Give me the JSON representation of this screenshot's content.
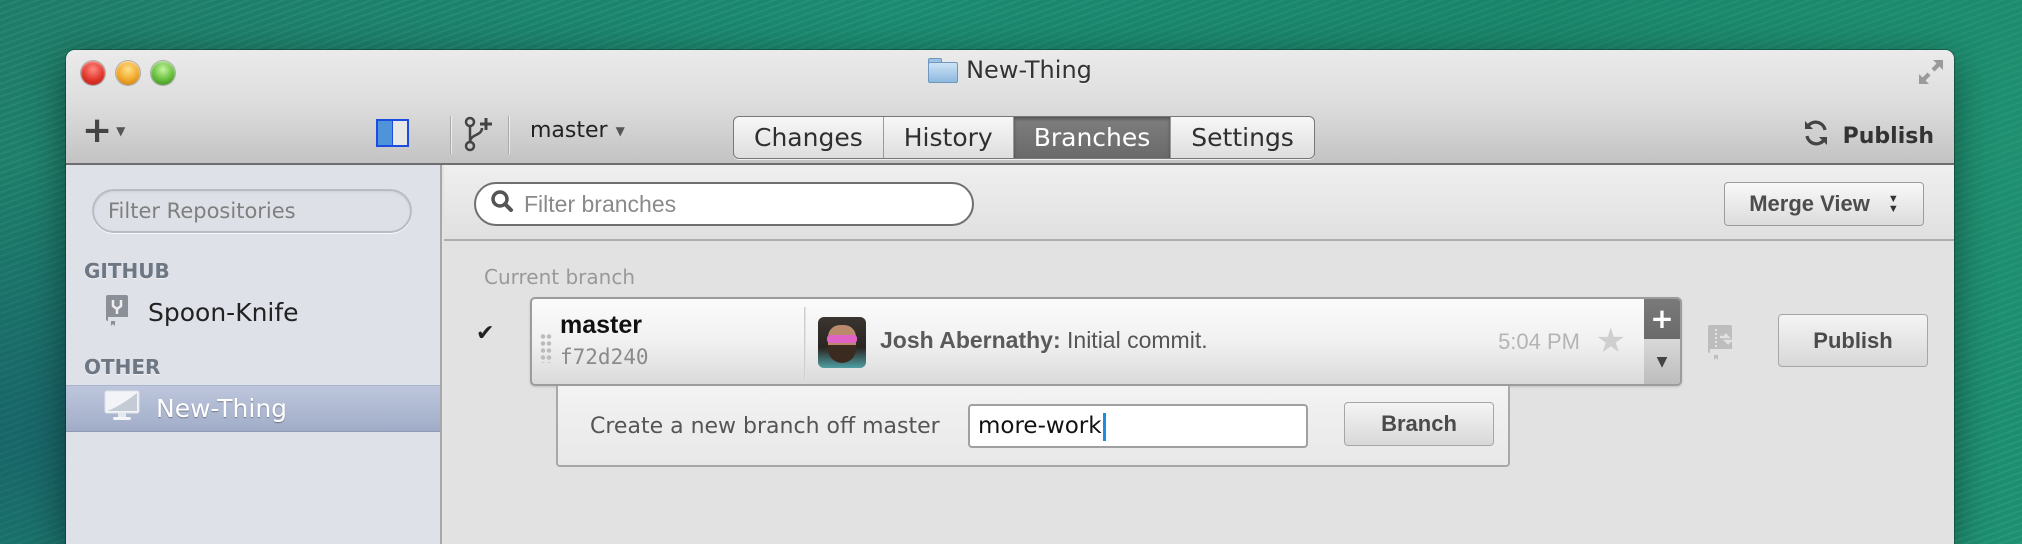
{
  "window": {
    "title": "New-Thing",
    "icons": {
      "folder": "folder-icon",
      "fullscreen": "fullscreen-arrows-icon"
    }
  },
  "toolbar": {
    "add_icon": "plus-icon",
    "sidebar_toggle_icon": "sidebar-toggle-icon",
    "new_branch_icon": "branch-plus-icon",
    "current_branch": "master",
    "tabs": [
      {
        "label": "Changes",
        "active": false
      },
      {
        "label": "History",
        "active": false
      },
      {
        "label": "Branches",
        "active": true
      },
      {
        "label": "Settings",
        "active": false
      }
    ],
    "publish_label": "Publish",
    "publish_icon": "sync-icon"
  },
  "sidebar": {
    "filter_placeholder": "Filter Repositories",
    "sections": [
      {
        "label": "GITHUB",
        "items": [
          {
            "name": "Spoon-Knife",
            "icon": "repo-icon",
            "selected": false
          }
        ]
      },
      {
        "label": "OTHER",
        "items": [
          {
            "name": "New-Thing",
            "icon": "computer-icon",
            "selected": true
          }
        ]
      }
    ]
  },
  "main": {
    "filter_placeholder": "Filter branches",
    "merge_view_label": "Merge View",
    "current_branch_heading": "Current branch",
    "current_branch": {
      "name": "master",
      "sha": "f72d240",
      "author": "Josh Abernathy:",
      "message": "Initial commit.",
      "time": "5:04 PM",
      "checked": true
    },
    "publish_label": "Publish",
    "new_branch": {
      "label": "Create a new branch off master",
      "input_value": "more-work",
      "button_label": "Branch"
    }
  }
}
